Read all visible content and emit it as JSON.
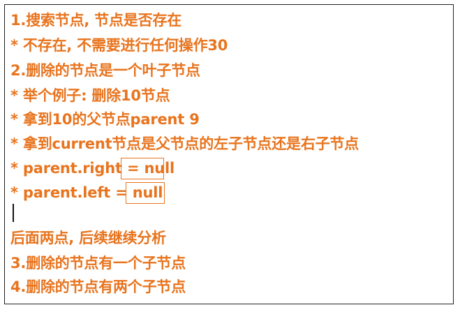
{
  "lines": [
    "1.搜索节点, 节点是否存在",
    "* 不存在, 不需要进行任何操作30",
    "2.删除的节点是一个叶子节点",
    "* 举个例子: 删除10节点",
    "* 拿到10的父节点parent 9",
    "* 拿到current节点是父节点的左子节点还是右子节点",
    "* parent.right = null",
    "* parent.left = null",
    "后面两点, 后续继续分析",
    "3.删除的节点有一个子节点",
    "4.删除的节点有两个子节点"
  ],
  "colors": {
    "text": "#e8741e",
    "border": "#1f1f1f",
    "cursor": "#111111",
    "background": "#ffffff"
  }
}
